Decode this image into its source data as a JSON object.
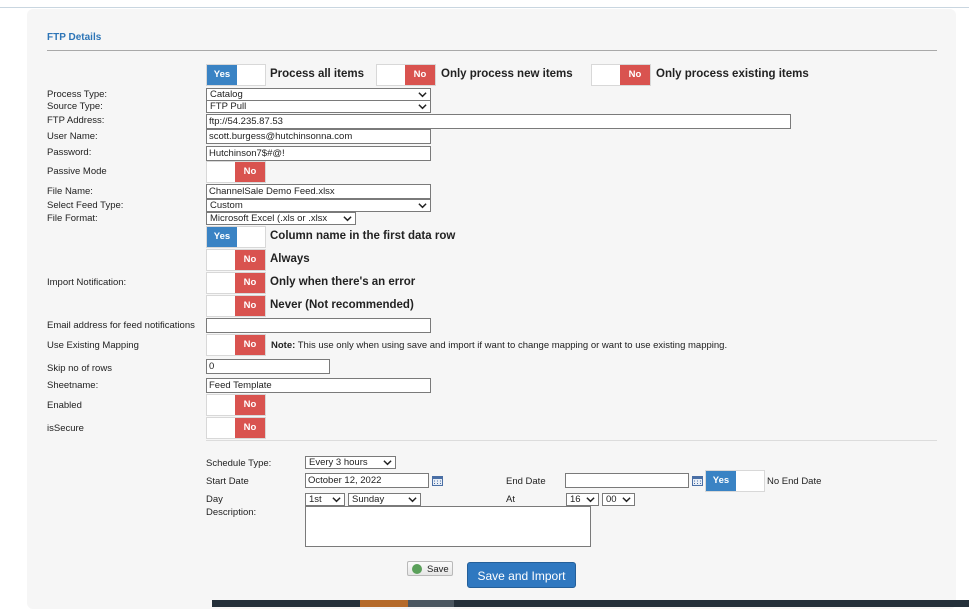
{
  "section_title": "FTP Details",
  "process_options": {
    "all": {
      "toggle": "Yes",
      "label": "Process all items"
    },
    "new": {
      "toggle": "No",
      "label": "Only process new items"
    },
    "existing": {
      "toggle": "No",
      "label": "Only process existing items"
    }
  },
  "labels": {
    "process_type": "Process Type:",
    "source_type": "Source Type:",
    "ftp_address": "FTP Address:",
    "user_name": "User Name:",
    "password": "Password:",
    "passive_mode": "Passive Mode",
    "file_name": "File Name:",
    "feed_type": "Select Feed Type:",
    "file_format": "File Format:",
    "import_notification": "Import Notification:",
    "email": "Email address for feed notifications",
    "use_existing_mapping": "Use Existing Mapping",
    "skip_rows": "Skip no of rows",
    "sheetname": "Sheetname:",
    "enabled": "Enabled",
    "is_secure": "isSecure"
  },
  "values": {
    "process_type": "Catalog",
    "source_type": "FTP Pull",
    "ftp_address": "ftp://54.235.87.53",
    "user_name": "scott.burgess@hutchinsonna.com",
    "password": "Hutchinson7$#@!",
    "file_name": "ChannelSale Demo Feed.xlsx",
    "feed_type": "Custom",
    "file_format": "Microsoft Excel (.xls or .xlsx",
    "email": "",
    "skip_rows": "0",
    "sheetname": "Feed Template"
  },
  "toggles": {
    "passive_mode": "No",
    "column_name_first_row": "Yes",
    "notif_always": "No",
    "notif_error": "No",
    "notif_never": "No",
    "use_existing_mapping": "No",
    "enabled": "No",
    "is_secure": "No",
    "no_end_date": "Yes"
  },
  "toggle_labels": {
    "column_name_first_row": "Column name in the first data row",
    "notif_always": "Always",
    "notif_error": "Only when there's an error",
    "notif_never": "Never (Not recommended)"
  },
  "mapping_note": {
    "bold": "Note:",
    "text": "This use only when using save and import if want to change mapping or want to use existing mapping."
  },
  "schedule": {
    "schedule_type_label": "Schedule Type:",
    "schedule_type": "Every 3 hours",
    "start_date_label": "Start Date",
    "start_date": "October 12, 2022",
    "end_date_label": "End Date",
    "end_date": "",
    "no_end_date_label": "No End Date",
    "day_label": "Day",
    "day_ordinal": "1st",
    "day_weekday": "Sunday",
    "at_label": "At",
    "hour": "16",
    "minute": "00",
    "description_label": "Description:",
    "description": ""
  },
  "buttons": {
    "save": "Save",
    "save_and_import": "Save and Import"
  },
  "colors": {
    "accent": "#2d75b7",
    "toggle_yes": "#3a83c4",
    "toggle_no": "#d9534f",
    "primary_button": "#2f78c0"
  }
}
